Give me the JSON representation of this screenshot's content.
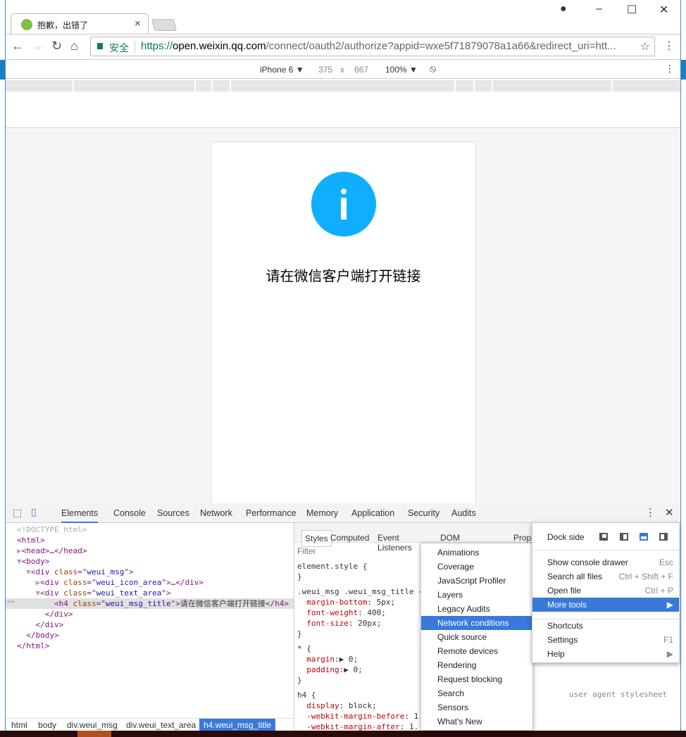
{
  "browser": {
    "tab_title": "抱歉，出错了",
    "security_label": "安全",
    "url_scheme": "https://",
    "url_host": "open.weixin.qq.com",
    "url_path": "/connect/oauth2/authorize?appid=wxe5f71879078a1a66&redirect_uri=htt..."
  },
  "device_toolbar": {
    "device": "iPhone 6 ▼",
    "width": "375",
    "times": "x",
    "height": "667",
    "zoom": "100% ▼"
  },
  "page": {
    "message": "请在微信客户端打开链接",
    "icon_color": "#10aeff",
    "icon": "info-icon"
  },
  "devtools": {
    "tabs": [
      "Elements",
      "Console",
      "Sources",
      "Network",
      "Performance",
      "Memory",
      "Application",
      "Security",
      "Audits"
    ],
    "dom": [
      {
        "indent": "",
        "parts": [
          [
            "gray",
            "<!DOCTYPE html>"
          ]
        ]
      },
      {
        "indent": "",
        "parts": [
          [
            "tag",
            "<html>"
          ]
        ]
      },
      {
        "indent": "▶",
        "parts": [
          [
            "tag",
            "<head>"
          ],
          [
            "",
            "…"
          ],
          [
            "tag",
            "</head>"
          ]
        ]
      },
      {
        "indent": "▼",
        "parts": [
          [
            "tag",
            "<body>"
          ]
        ]
      },
      {
        "indent": "  ▼",
        "parts": [
          [
            "tag",
            "<div "
          ],
          [
            "attr",
            "class"
          ],
          [
            "tag",
            "=\""
          ],
          [
            "val",
            "weui_msg"
          ],
          [
            "tag",
            "\">"
          ]
        ]
      },
      {
        "indent": "    ▶",
        "parts": [
          [
            "tag",
            "<div "
          ],
          [
            "attr",
            "class"
          ],
          [
            "tag",
            "=\""
          ],
          [
            "val",
            "weui_icon_area"
          ],
          [
            "tag",
            "\">"
          ],
          [
            "",
            "…"
          ],
          [
            "tag",
            "</div>"
          ]
        ]
      },
      {
        "indent": "    ▼",
        "parts": [
          [
            "tag",
            "<div "
          ],
          [
            "attr",
            "class"
          ],
          [
            "tag",
            "=\""
          ],
          [
            "val",
            "weui_text_area"
          ],
          [
            "tag",
            "\">"
          ]
        ]
      },
      {
        "indent": "        ",
        "parts": [
          [
            "tag",
            "<h4 "
          ],
          [
            "attr",
            "class"
          ],
          [
            "tag",
            "=\""
          ],
          [
            "val",
            "weui_msg_title"
          ],
          [
            "tag",
            "\">"
          ],
          [
            "",
            "请在微信客户端打开链接"
          ],
          [
            "tag",
            "</h4>"
          ]
        ]
      },
      {
        "indent": "      ",
        "parts": [
          [
            "tag",
            "</div>"
          ]
        ]
      },
      {
        "indent": "    ",
        "parts": [
          [
            "tag",
            "</div>"
          ]
        ]
      },
      {
        "indent": "  ",
        "parts": [
          [
            "tag",
            "</body>"
          ]
        ]
      },
      {
        "indent": "",
        "parts": [
          [
            "tag",
            "</html>"
          ]
        ]
      }
    ],
    "styles_tabs": [
      "Styles",
      "Computed",
      "Event Listeners",
      "DOM Breakpoints",
      "Prop"
    ],
    "filter_placeholder": "Filter",
    "styles": [
      [
        [
          "",
          "element.style {"
        ]
      ],
      [
        [
          "",
          "}"
        ]
      ],
      [
        [
          "",
          ".weui_msg .weui_msg_title {"
        ]
      ],
      [
        [
          "prop",
          "  margin-bottom"
        ],
        [
          "",
          ": 5px;"
        ]
      ],
      [
        [
          "prop",
          "  font-weight"
        ],
        [
          "",
          ": 400;"
        ]
      ],
      [
        [
          "prop",
          "  font-size"
        ],
        [
          "",
          ": 20px;"
        ]
      ],
      [
        [
          "",
          "}"
        ]
      ],
      [
        [
          "",
          "* {"
        ]
      ],
      [
        [
          "prop",
          "  margin"
        ],
        [
          "",
          ":▶ 0;"
        ]
      ],
      [
        [
          "prop",
          "  padding"
        ],
        [
          "",
          ":▶ 0;"
        ]
      ],
      [
        [
          "",
          "}"
        ]
      ],
      [
        [
          "",
          "h4 {"
        ]
      ],
      [
        [
          "prop",
          "  display"
        ],
        [
          "",
          ": block;"
        ]
      ],
      [
        [
          "prop",
          "  -webkit-margin-before"
        ],
        [
          "",
          ": 1"
        ]
      ],
      [
        [
          "prop",
          "  -webkit-margin-after"
        ],
        [
          "",
          ": 1."
        ]
      ]
    ],
    "ua_stylesheet": "user agent stylesheet",
    "breadcrumbs": [
      "html",
      "body",
      "div.weui_msg",
      "div.weui_text_area",
      "h4.weui_msg_title"
    ],
    "main_menu": {
      "dock_side": "Dock side",
      "items": [
        {
          "label": "Show console drawer",
          "shortcut": "Esc"
        },
        {
          "label": "Search all files",
          "shortcut": "Ctrl + Shift + F"
        },
        {
          "label": "Open file",
          "shortcut": "Ctrl + P"
        },
        {
          "label": "More tools",
          "shortcut": "▶",
          "highlighted": true
        },
        {
          "label": "Shortcuts",
          "shortcut": ""
        },
        {
          "label": "Settings",
          "shortcut": "F1"
        },
        {
          "label": "Help",
          "shortcut": "▶"
        }
      ]
    },
    "more_tools": [
      "Animations",
      "Coverage",
      "JavaScript Profiler",
      "Layers",
      "Legacy Audits",
      "Network conditions",
      "Quick source",
      "Remote devices",
      "Rendering",
      "Request blocking",
      "Search",
      "Sensors",
      "What's New"
    ],
    "more_tools_highlighted": "Network conditions",
    "accent": "#3879d9"
  }
}
